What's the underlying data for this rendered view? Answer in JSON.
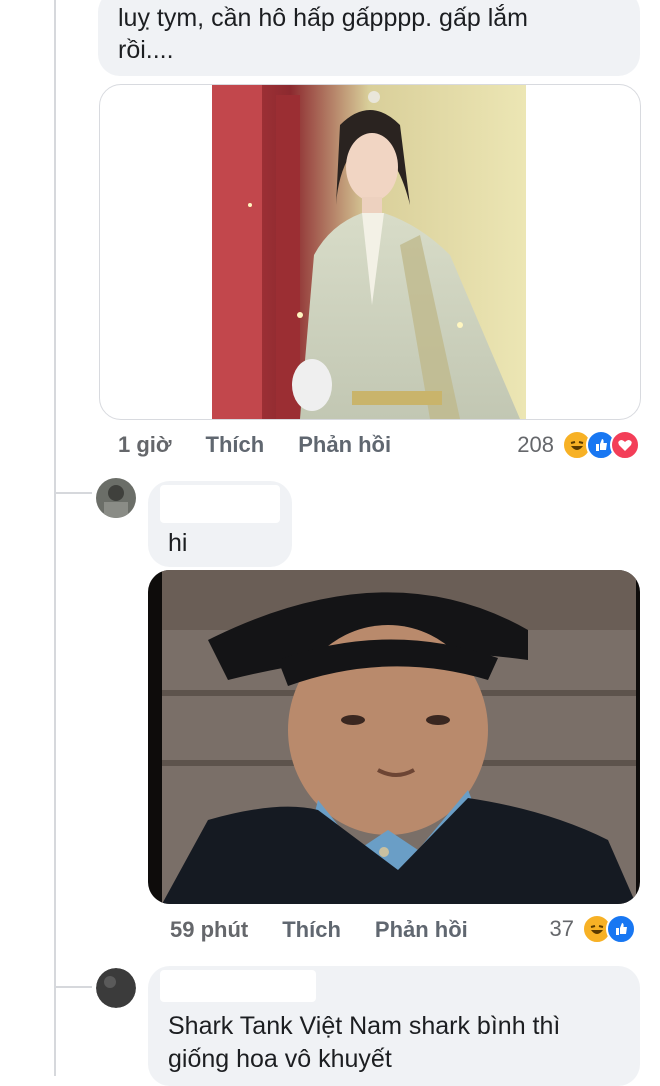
{
  "comment1": {
    "text_line1": "luỵ tym, cần hô hấp gấpppp. gấp lắm",
    "text_line2": "rồi....",
    "time": "1 giờ",
    "like_label": "Thích",
    "reply_label": "Phản hồi",
    "reaction_count": "208",
    "reactions": [
      "haha-icon",
      "like-icon",
      "love-icon"
    ]
  },
  "comment2": {
    "text": "hi",
    "time": "59 phút",
    "like_label": "Thích",
    "reply_label": "Phản hồi",
    "reaction_count": "37",
    "reactions": [
      "haha-icon",
      "like-icon"
    ]
  },
  "comment3": {
    "text_line1": "Shark Tank Việt Nam shark bình thì",
    "text_line2": "giống hoa vô khuyết"
  },
  "colors": {
    "bubble": "#f0f2f5",
    "meta_text": "#65676b",
    "like_blue": "#1877f2",
    "love_red": "#f33e58",
    "haha_yellow": "#f7b125"
  }
}
